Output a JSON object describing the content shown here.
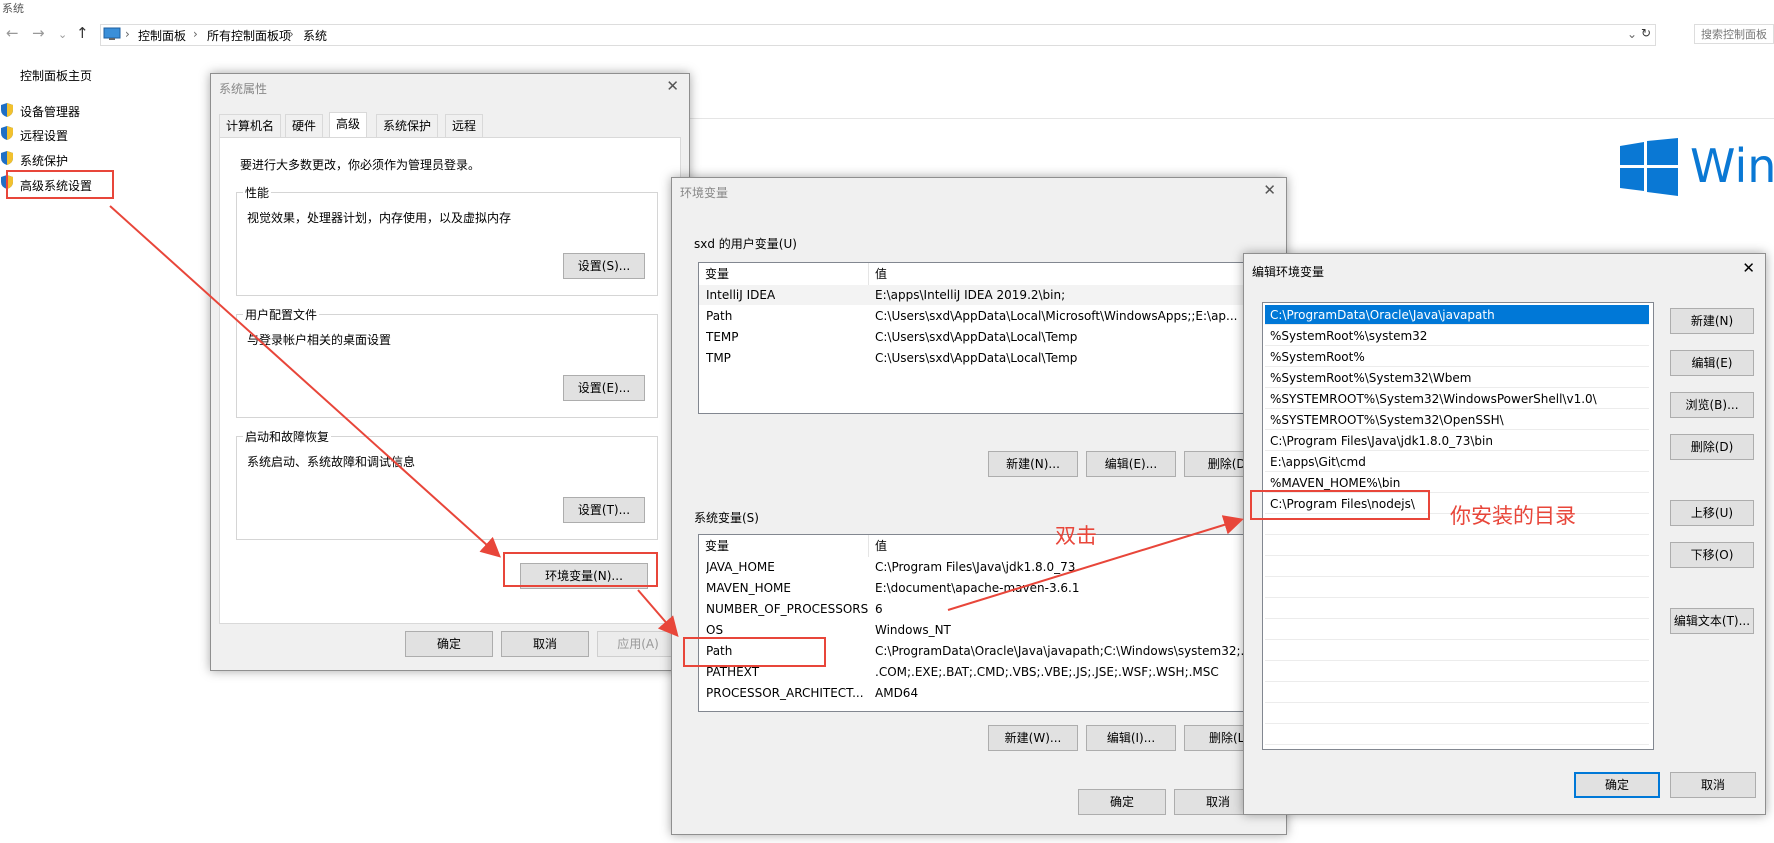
{
  "window": {
    "title": "系统"
  },
  "explorer": {
    "back_icon": "←",
    "forward_icon": "→",
    "up_icon": "↑",
    "breadcrumbs": [
      "控制面板",
      "所有控制面板项",
      "系统"
    ],
    "refresh_icon": "↻",
    "search_placeholder": "搜索控制面板"
  },
  "left_nav": {
    "home": "控制面板主页",
    "items": [
      "设备管理器",
      "远程设置",
      "系统保护",
      "高级系统设置"
    ]
  },
  "brand": {
    "text": "Windo"
  },
  "sys_props": {
    "title": "系统属性",
    "tabs": [
      "计算机名",
      "硬件",
      "高级",
      "系统保护",
      "远程"
    ],
    "notice": "要进行大多数更改，你必须作为管理员登录。",
    "perf": {
      "label": "性能",
      "desc": "视觉效果，处理器计划，内存使用，以及虚拟内存",
      "button": "设置(S)..."
    },
    "profile": {
      "label": "用户配置文件",
      "desc": "与登录帐户相关的桌面设置",
      "button": "设置(E)..."
    },
    "startup": {
      "label": "启动和故障恢复",
      "desc": "系统启动、系统故障和调试信息",
      "button": "设置(T)..."
    },
    "env_button": "环境变量(N)...",
    "ok": "确定",
    "cancel": "取消",
    "apply": "应用(A)"
  },
  "env_vars": {
    "title": "环境变量",
    "user_label": "sxd 的用户变量(U)",
    "col_var": "变量",
    "col_val": "值",
    "user_rows": [
      {
        "name": "IntelliJ IDEA",
        "value": "E:\\apps\\IntelliJ IDEA 2019.2\\bin;"
      },
      {
        "name": "Path",
        "value": "C:\\Users\\sxd\\AppData\\Local\\Microsoft\\WindowsApps;;E:\\ap..."
      },
      {
        "name": "TEMP",
        "value": "C:\\Users\\sxd\\AppData\\Local\\Temp"
      },
      {
        "name": "TMP",
        "value": "C:\\Users\\sxd\\AppData\\Local\\Temp"
      }
    ],
    "user_new": "新建(N)...",
    "user_edit": "编辑(E)...",
    "user_delete": "删除(D)",
    "sys_label": "系统变量(S)",
    "sys_rows": [
      {
        "name": "JAVA_HOME",
        "value": "C:\\Program Files\\Java\\jdk1.8.0_73"
      },
      {
        "name": "MAVEN_HOME",
        "value": "E:\\document\\apache-maven-3.6.1"
      },
      {
        "name": "NUMBER_OF_PROCESSORS",
        "value": "6"
      },
      {
        "name": "OS",
        "value": "Windows_NT"
      },
      {
        "name": "Path",
        "value": "C:\\ProgramData\\Oracle\\Java\\javapath;C:\\Windows\\system32;..."
      },
      {
        "name": "PATHEXT",
        "value": ".COM;.EXE;.BAT;.CMD;.VBS;.VBE;.JS;.JSE;.WSF;.WSH;.MSC"
      },
      {
        "name": "PROCESSOR_ARCHITECT...",
        "value": "AMD64"
      }
    ],
    "sys_new": "新建(W)...",
    "sys_edit": "编辑(I)...",
    "sys_delete": "删除(L)",
    "ok": "确定",
    "cancel": "取消"
  },
  "edit_env": {
    "title": "编辑环境变量",
    "entries": [
      "C:\\ProgramData\\Oracle\\Java\\javapath",
      "%SystemRoot%\\system32",
      "%SystemRoot%",
      "%SystemRoot%\\System32\\Wbem",
      "%SYSTEMROOT%\\System32\\WindowsPowerShell\\v1.0\\",
      "%SYSTEMROOT%\\System32\\OpenSSH\\",
      "C:\\Program Files\\Java\\jdk1.8.0_73\\bin",
      "E:\\apps\\Git\\cmd",
      "%MAVEN_HOME%\\bin",
      "C:\\Program Files\\nodejs\\"
    ],
    "new": "新建(N)",
    "edit": "编辑(E)",
    "browse": "浏览(B)...",
    "delete": "删除(D)",
    "move_up": "上移(U)",
    "move_down": "下移(O)",
    "edit_text": "编辑文本(T)...",
    "ok": "确定",
    "cancel": "取消"
  },
  "annotations": {
    "double_click": "双击",
    "install_dir": "你安装的目录"
  },
  "colors": {
    "accent": "#0078d7",
    "annotation": "#e8463a",
    "dialog_bg": "#f0f0f0"
  }
}
